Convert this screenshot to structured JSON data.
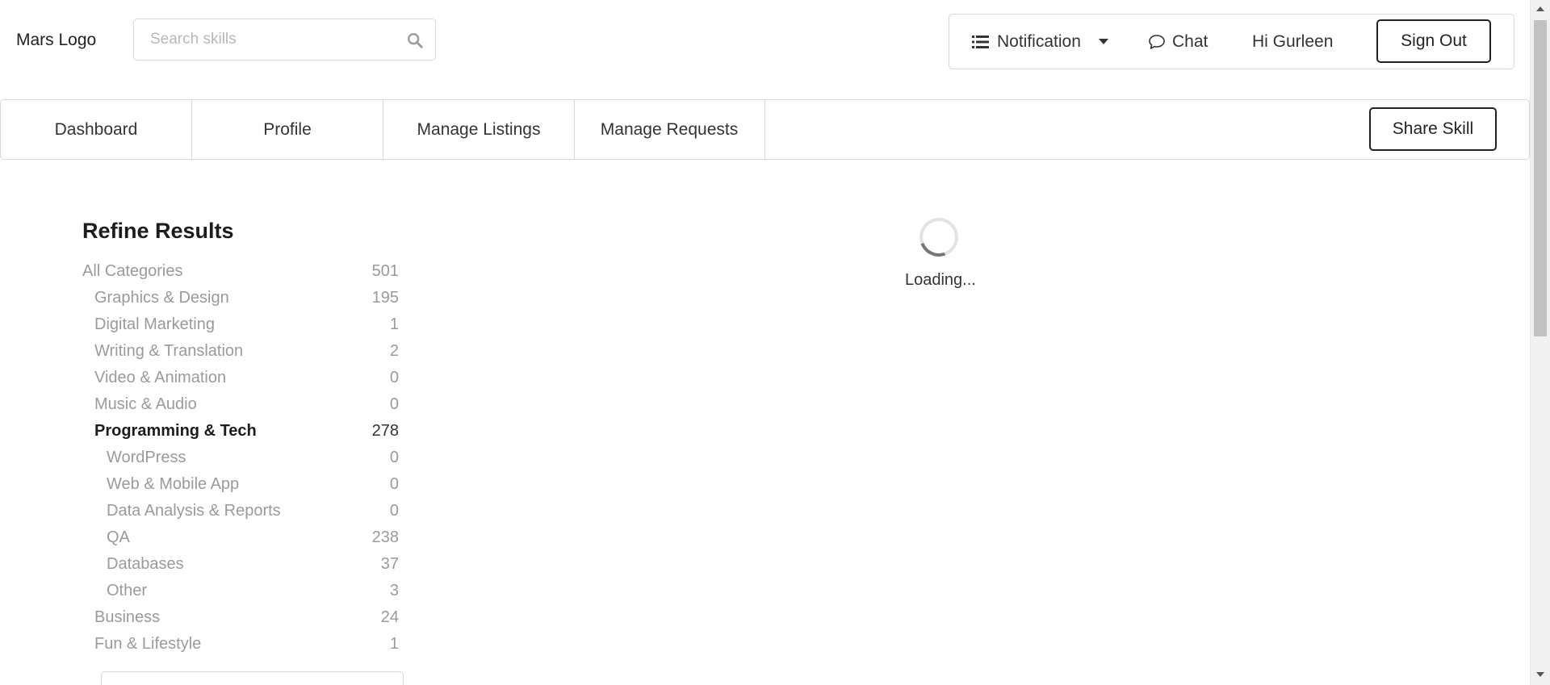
{
  "header": {
    "logo": "Mars Logo",
    "search_placeholder": "Search skills",
    "notification_label": "Notification",
    "chat_label": "Chat",
    "greeting": "Hi Gurleen",
    "signout_label": "Sign Out"
  },
  "tabs": [
    {
      "label": "Dashboard"
    },
    {
      "label": "Profile"
    },
    {
      "label": "Manage Listings"
    },
    {
      "label": "Manage Requests"
    }
  ],
  "share_label": "Share Skill",
  "refine": {
    "title": "Refine Results",
    "categories": [
      {
        "label": "All Categories",
        "count": "501",
        "level": 0,
        "active": false
      },
      {
        "label": "Graphics & Design",
        "count": "195",
        "level": 1,
        "active": false
      },
      {
        "label": "Digital Marketing",
        "count": "1",
        "level": 1,
        "active": false
      },
      {
        "label": "Writing & Translation",
        "count": "2",
        "level": 1,
        "active": false
      },
      {
        "label": "Video & Animation",
        "count": "0",
        "level": 1,
        "active": false
      },
      {
        "label": "Music & Audio",
        "count": "0",
        "level": 1,
        "active": false
      },
      {
        "label": "Programming & Tech",
        "count": "278",
        "level": 1,
        "active": true
      },
      {
        "label": "WordPress",
        "count": "0",
        "level": 2,
        "active": false
      },
      {
        "label": "Web & Mobile App",
        "count": "0",
        "level": 2,
        "active": false
      },
      {
        "label": "Data Analysis & Reports",
        "count": "0",
        "level": 2,
        "active": false
      },
      {
        "label": "QA",
        "count": "238",
        "level": 2,
        "active": false
      },
      {
        "label": "Databases",
        "count": "37",
        "level": 2,
        "active": false
      },
      {
        "label": "Other",
        "count": "3",
        "level": 2,
        "active": false
      },
      {
        "label": "Business",
        "count": "24",
        "level": 1,
        "active": false
      },
      {
        "label": "Fun & Lifestyle",
        "count": "1",
        "level": 1,
        "active": false
      }
    ]
  },
  "loading_text": "Loading...",
  "icons": {
    "search": "search-icon",
    "notification": "list-icon",
    "dropdown": "caret-down-icon",
    "chat": "chat-bubble-icon"
  }
}
